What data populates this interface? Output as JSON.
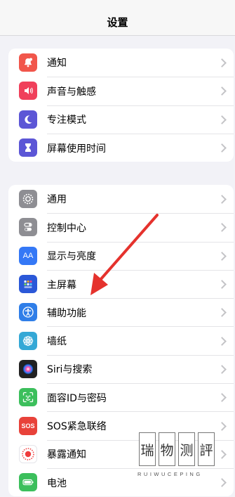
{
  "nav": {
    "title": "设置"
  },
  "group1": [
    {
      "label": "通知",
      "icon": "notifications-icon",
      "color": "#f1564b"
    },
    {
      "label": "声音与触感",
      "icon": "sound-icon",
      "color": "#f0405b"
    },
    {
      "label": "专注模式",
      "icon": "focus-moon-icon",
      "color": "#5c56d6"
    },
    {
      "label": "屏幕使用时间",
      "icon": "hourglass-icon",
      "color": "#5c56d6"
    }
  ],
  "group2": [
    {
      "label": "通用",
      "icon": "gear-icon",
      "color": "#8e8e93"
    },
    {
      "label": "控制中心",
      "icon": "control-center-icon",
      "color": "#8e8e93"
    },
    {
      "label": "显示与亮度",
      "icon": "display-aa-icon",
      "color": "#3478f6",
      "glyph": "AA"
    },
    {
      "label": "主屏幕",
      "icon": "home-screen-icon",
      "color": "#2b58d8"
    },
    {
      "label": "辅助功能",
      "icon": "accessibility-icon",
      "color": "#2f7ee8"
    },
    {
      "label": "墙纸",
      "icon": "wallpaper-flower-icon",
      "color": "#34a8d6"
    },
    {
      "label": "Siri与搜索",
      "icon": "siri-icon",
      "color": "#222222"
    },
    {
      "label": "面容ID与密码",
      "icon": "face-id-icon",
      "color": "#3cbf5c"
    },
    {
      "label": "SOS紧急联络",
      "icon": "sos-icon",
      "color": "#e8423a",
      "glyph": "SOS"
    },
    {
      "label": "暴露通知",
      "icon": "exposure-icon",
      "color": "#ffffff"
    },
    {
      "label": "电池",
      "icon": "battery-icon",
      "color": "#3cbf5c"
    }
  ],
  "watermark": {
    "chars": [
      "瑞",
      "物",
      "测",
      "評"
    ],
    "subtitle": "RUIWUCEPING"
  }
}
